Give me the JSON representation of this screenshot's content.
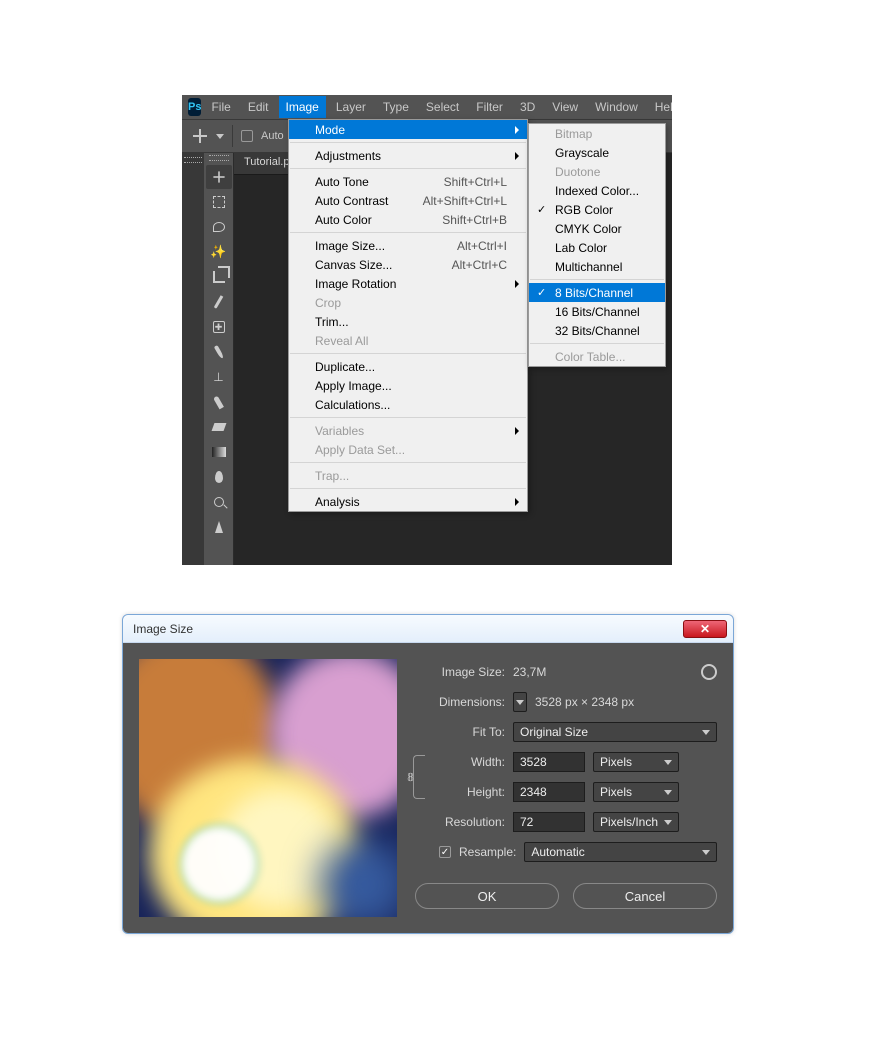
{
  "ps": {
    "logo_text": "Ps",
    "menubar": [
      "File",
      "Edit",
      "Image",
      "Layer",
      "Type",
      "Select",
      "Filter",
      "3D",
      "View",
      "Window",
      "Help"
    ],
    "active_menu_index": 2,
    "optionsbar": {
      "auto_select_label": "Auto"
    },
    "doc_tab": "Tutorial.ps",
    "image_menu": [
      {
        "label": "Mode",
        "submenu": true,
        "hl": true
      },
      {
        "sep": true
      },
      {
        "label": "Adjustments",
        "submenu": true
      },
      {
        "sep": true
      },
      {
        "label": "Auto Tone",
        "shortcut": "Shift+Ctrl+L"
      },
      {
        "label": "Auto Contrast",
        "shortcut": "Alt+Shift+Ctrl+L"
      },
      {
        "label": "Auto Color",
        "shortcut": "Shift+Ctrl+B"
      },
      {
        "sep": true
      },
      {
        "label": "Image Size...",
        "shortcut": "Alt+Ctrl+I"
      },
      {
        "label": "Canvas Size...",
        "shortcut": "Alt+Ctrl+C"
      },
      {
        "label": "Image Rotation",
        "submenu": true
      },
      {
        "label": "Crop",
        "dis": true
      },
      {
        "label": "Trim..."
      },
      {
        "label": "Reveal All",
        "dis": true
      },
      {
        "sep": true
      },
      {
        "label": "Duplicate..."
      },
      {
        "label": "Apply Image..."
      },
      {
        "label": "Calculations..."
      },
      {
        "sep": true
      },
      {
        "label": "Variables",
        "submenu": true,
        "dis": true
      },
      {
        "label": "Apply Data Set...",
        "dis": true
      },
      {
        "sep": true
      },
      {
        "label": "Trap...",
        "dis": true
      },
      {
        "sep": true
      },
      {
        "label": "Analysis",
        "submenu": true
      }
    ],
    "mode_menu": [
      {
        "label": "Bitmap",
        "dis": true
      },
      {
        "label": "Grayscale"
      },
      {
        "label": "Duotone",
        "dis": true
      },
      {
        "label": "Indexed Color..."
      },
      {
        "label": "RGB Color",
        "check": true
      },
      {
        "label": "CMYK Color"
      },
      {
        "label": "Lab Color"
      },
      {
        "label": "Multichannel"
      },
      {
        "sep": true
      },
      {
        "label": "8 Bits/Channel",
        "check": true,
        "hl": true
      },
      {
        "label": "16 Bits/Channel"
      },
      {
        "label": "32 Bits/Channel"
      },
      {
        "sep": true
      },
      {
        "label": "Color Table...",
        "dis": true
      }
    ]
  },
  "tools": [
    "move",
    "marquee",
    "lasso",
    "wand",
    "crop",
    "eyedropper",
    "heal",
    "brush",
    "stamp",
    "history",
    "eraser",
    "gradient",
    "blur",
    "dodge",
    "pen"
  ],
  "is": {
    "title": "Image Size",
    "image_size_label": "Image Size:",
    "image_size_value": "23,7M",
    "dimensions_label": "Dimensions:",
    "dimensions_value": "3528 px  ×  2348 px",
    "fit_to_label": "Fit To:",
    "fit_to_value": "Original Size",
    "width_label": "Width:",
    "width_value": "3528",
    "width_unit": "Pixels",
    "height_label": "Height:",
    "height_value": "2348",
    "height_unit": "Pixels",
    "resolution_label": "Resolution:",
    "resolution_value": "72",
    "resolution_unit": "Pixels/Inch",
    "resample_label": "Resample:",
    "resample_value": "Automatic",
    "ok_label": "OK",
    "cancel_label": "Cancel"
  }
}
